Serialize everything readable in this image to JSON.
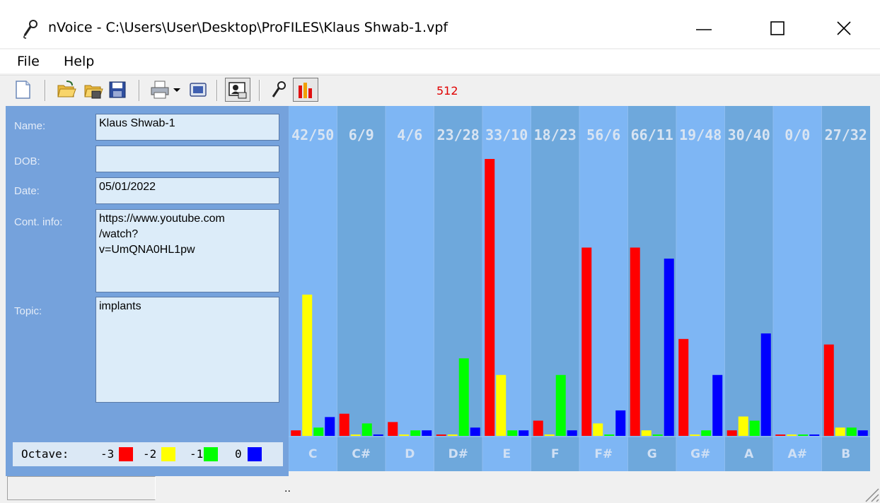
{
  "window": {
    "title": "nVoice - C:\\Users\\User\\Desktop\\ProFILES\\Klaus Shwab-1.vpf",
    "app_icon": "microphone-icon"
  },
  "menu": {
    "file": "File",
    "help": "Help"
  },
  "toolbar": {
    "icons": [
      "new-icon",
      "open-icon",
      "open-recent-icon",
      "save-icon",
      "print-icon",
      "dropdown-arrow-icon",
      "screen-icon",
      "profile-card-icon",
      "microphone-icon",
      "chart-icon"
    ],
    "sample_count": "512"
  },
  "profile": {
    "name_label": "Name:",
    "name_value": "Klaus Shwab-1",
    "dob_label": "DOB:",
    "dob_value": "",
    "date_label": "Date:",
    "date_value": "05/01/2022",
    "contact_label": "Cont. info:",
    "contact_value": "https://www.youtube.com\n/watch?\nv=UmQNA0HL1pw",
    "topic_label": "Topic:",
    "topic_value": "implants"
  },
  "octave_legend": {
    "title": "Octave:",
    "items": [
      {
        "label": "-3",
        "color": "#ff0000"
      },
      {
        "label": "-2",
        "color": "#ffff00"
      },
      {
        "label": "-1",
        "color": "#00ff00"
      },
      {
        "label": "0",
        "color": "#0000ff"
      }
    ]
  },
  "colors": {
    "panel": "#75a2dc",
    "chart_bg_dark": "#6ea8dc",
    "chart_bg_light": "#7eb6f4",
    "note_label": "#d0e0f4",
    "header_text": "#d8e4f2"
  },
  "chart_data": {
    "type": "bar",
    "categories": [
      "C",
      "C#",
      "D",
      "D#",
      "E",
      "F",
      "F#",
      "G",
      "G#",
      "A",
      "A#",
      "B"
    ],
    "header_labels": [
      "42/50",
      "6/9",
      "4/6",
      "23/28",
      "33/10",
      "18/23",
      "56/6",
      "66/11",
      "19/48",
      "30/40",
      "0/0",
      "27/32"
    ],
    "series": [
      {
        "name": "-3",
        "color": "#ff0000",
        "values": [
          0.02,
          0.08,
          0.05,
          0.005,
          1.0,
          0.055,
          0.68,
          0.68,
          0.35,
          0.02,
          0.005,
          0.33
        ]
      },
      {
        "name": "-2",
        "color": "#ffff00",
        "values": [
          0.51,
          0.005,
          0.005,
          0.005,
          0.22,
          0.005,
          0.045,
          0.02,
          0.005,
          0.07,
          0.005,
          0.03
        ]
      },
      {
        "name": "-1",
        "color": "#00ff00",
        "values": [
          0.03,
          0.045,
          0.02,
          0.28,
          0.02,
          0.22,
          0.005,
          0.005,
          0.02,
          0.055,
          0.005,
          0.03
        ]
      },
      {
        "name": "0",
        "color": "#0000ff",
        "values": [
          0.068,
          0.005,
          0.02,
          0.03,
          0.02,
          0.02,
          0.092,
          0.64,
          0.22,
          0.37,
          0.005,
          0.02
        ]
      }
    ],
    "ylim": [
      0,
      1
    ],
    "grid": false
  },
  "status": {
    "text": ".."
  }
}
